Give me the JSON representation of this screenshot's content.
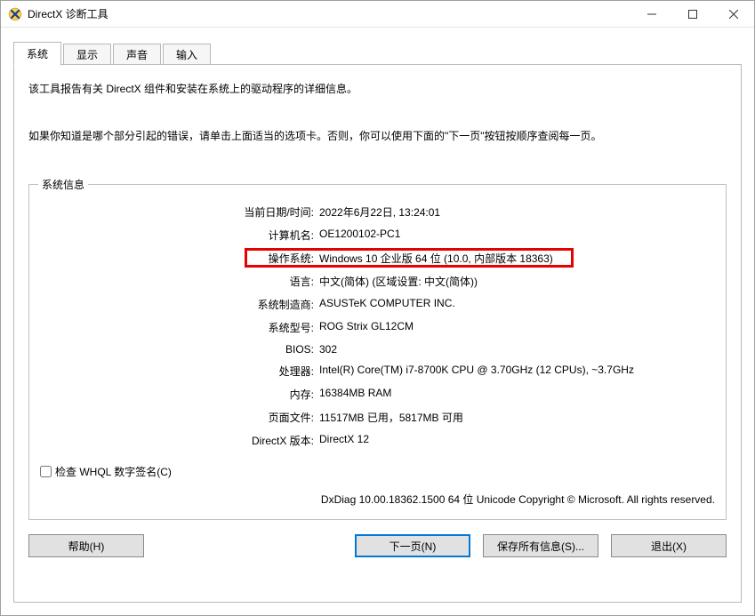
{
  "window": {
    "title": "DirectX 诊断工具"
  },
  "tabs": {
    "system": "系统",
    "display": "显示",
    "sound": "声音",
    "input": "输入"
  },
  "intro": {
    "line1": "该工具报告有关 DirectX 组件和安装在系统上的驱动程序的详细信息。",
    "line2": "如果你知道是哪个部分引起的错误，请单击上面适当的选项卡。否则，你可以使用下面的\"下一页\"按钮按顺序查阅每一页。"
  },
  "group": {
    "legend": "系统信息",
    "labels": {
      "datetime": "当前日期/时间:",
      "computer": "计算机名:",
      "os": "操作系统:",
      "lang": "语言:",
      "maker": "系统制造商:",
      "model": "系统型号:",
      "bios": "BIOS:",
      "cpu": "处理器:",
      "mem": "内存:",
      "pagefile": "页面文件:",
      "dxver": "DirectX 版本:"
    },
    "values": {
      "datetime": "2022年6月22日, 13:24:01",
      "computer": "OE1200102-PC1",
      "os": "Windows 10 企业版 64 位 (10.0, 内部版本 18363)",
      "lang": "中文(简体) (区域设置: 中文(简体))",
      "maker": "ASUSTeK COMPUTER INC.",
      "model": "ROG Strix GL12CM",
      "bios": "302",
      "cpu": "Intel(R) Core(TM) i7-8700K CPU @ 3.70GHz (12 CPUs), ~3.7GHz",
      "mem": "16384MB RAM",
      "pagefile": "11517MB 已用，5817MB 可用",
      "dxver": "DirectX 12"
    }
  },
  "whql": {
    "label": "检查 WHQL 数字签名(C)"
  },
  "copyright": "DxDiag 10.00.18362.1500 64 位 Unicode  Copyright © Microsoft. All rights reserved.",
  "buttons": {
    "help": "帮助(H)",
    "next": "下一页(N)",
    "saveall": "保存所有信息(S)...",
    "exit": "退出(X)"
  }
}
